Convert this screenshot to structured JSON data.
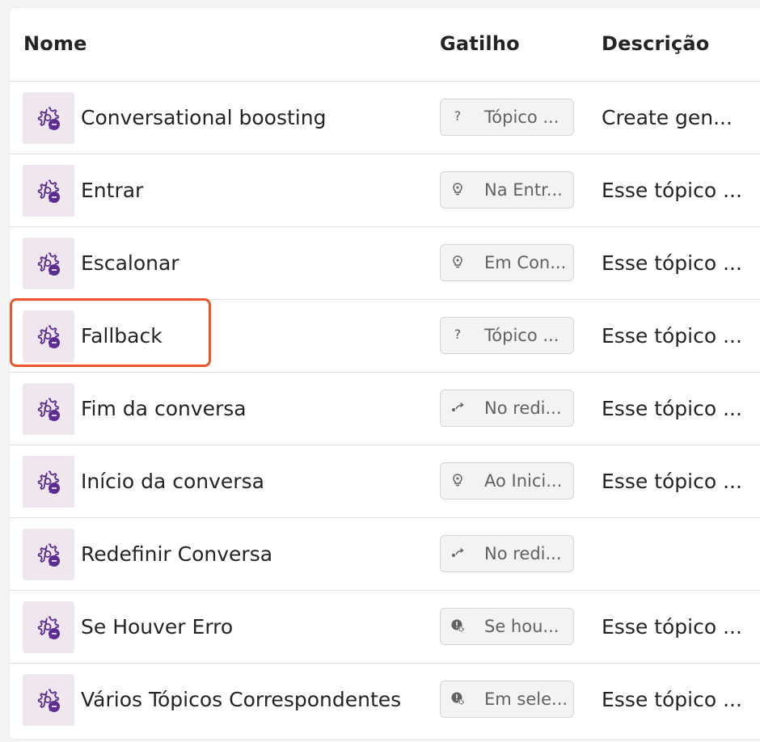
{
  "headers": {
    "name": "Nome",
    "trigger": "Gatilho",
    "description": "Descrição"
  },
  "colors": {
    "icon_bg": "#efe6ef",
    "icon_fg": "#5c2e91",
    "highlight": "#e8562a"
  },
  "rows": [
    {
      "name": "Conversational boosting",
      "trigger_icon": "question-icon",
      "trigger": "Tópico ...",
      "description": "Create gen..."
    },
    {
      "name": "Entrar",
      "trigger_icon": "bulb-icon",
      "trigger": "Na Entr...",
      "description": "Esse tópico ..."
    },
    {
      "name": "Escalonar",
      "trigger_icon": "bulb-icon",
      "trigger": "Em Con...",
      "description": "Esse tópico ..."
    },
    {
      "name": "Fallback",
      "trigger_icon": "question-icon",
      "trigger": "Tópico ...",
      "description": "Esse tópico ..."
    },
    {
      "name": "Fim da conversa",
      "trigger_icon": "redirect-icon",
      "trigger": "No redi...",
      "description": "Esse tópico ..."
    },
    {
      "name": "Início da conversa",
      "trigger_icon": "bulb-icon",
      "trigger": "Ao Inici...",
      "description": "Esse tópico ..."
    },
    {
      "name": "Redefinir Conversa",
      "trigger_icon": "redirect-icon",
      "trigger": "No redi...",
      "description": ""
    },
    {
      "name": "Se Houver Erro",
      "trigger_icon": "error-gear-icon",
      "trigger": "Se hou...",
      "description": "Esse tópico ..."
    },
    {
      "name": "Vários Tópicos Correspondentes",
      "trigger_icon": "error-gear-icon",
      "trigger": "Em sele...",
      "description": "Esse tópico ..."
    }
  ]
}
